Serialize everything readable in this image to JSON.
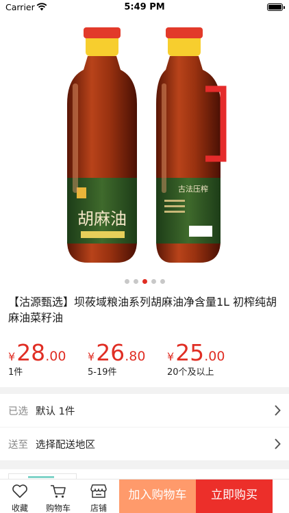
{
  "status": {
    "carrier": "Carrier",
    "time": "5:49 PM"
  },
  "gallery": {
    "label_left": "胡麻油",
    "label_right": "古法压榨",
    "pages": 5,
    "active_page": 3
  },
  "product": {
    "title": "【沽源甄选】坝莜域粮油系列胡麻油净含量1L 初榨纯胡麻油菜籽油",
    "prices": [
      {
        "symbol": "¥",
        "int": "28",
        "dec": ".00",
        "qty": "1件"
      },
      {
        "symbol": "¥",
        "int": "26",
        "dec": ".80",
        "qty": "5-19件"
      },
      {
        "symbol": "¥",
        "int": "25",
        "dec": ".00",
        "qty": "20个及以上"
      }
    ]
  },
  "options": {
    "selected": {
      "label": "已选",
      "value": "默认 1件"
    },
    "ship": {
      "label": "送至",
      "value": "选择配送地区"
    }
  },
  "bottom_bar": {
    "favorite": "收藏",
    "cart": "购物车",
    "store": "店铺",
    "add_to_cart": "加入购物车",
    "buy_now": "立即购买"
  },
  "colors": {
    "accent": "#e02e24",
    "cart_button": "#ff9a6b",
    "buy_button": "#ec2f2a"
  }
}
